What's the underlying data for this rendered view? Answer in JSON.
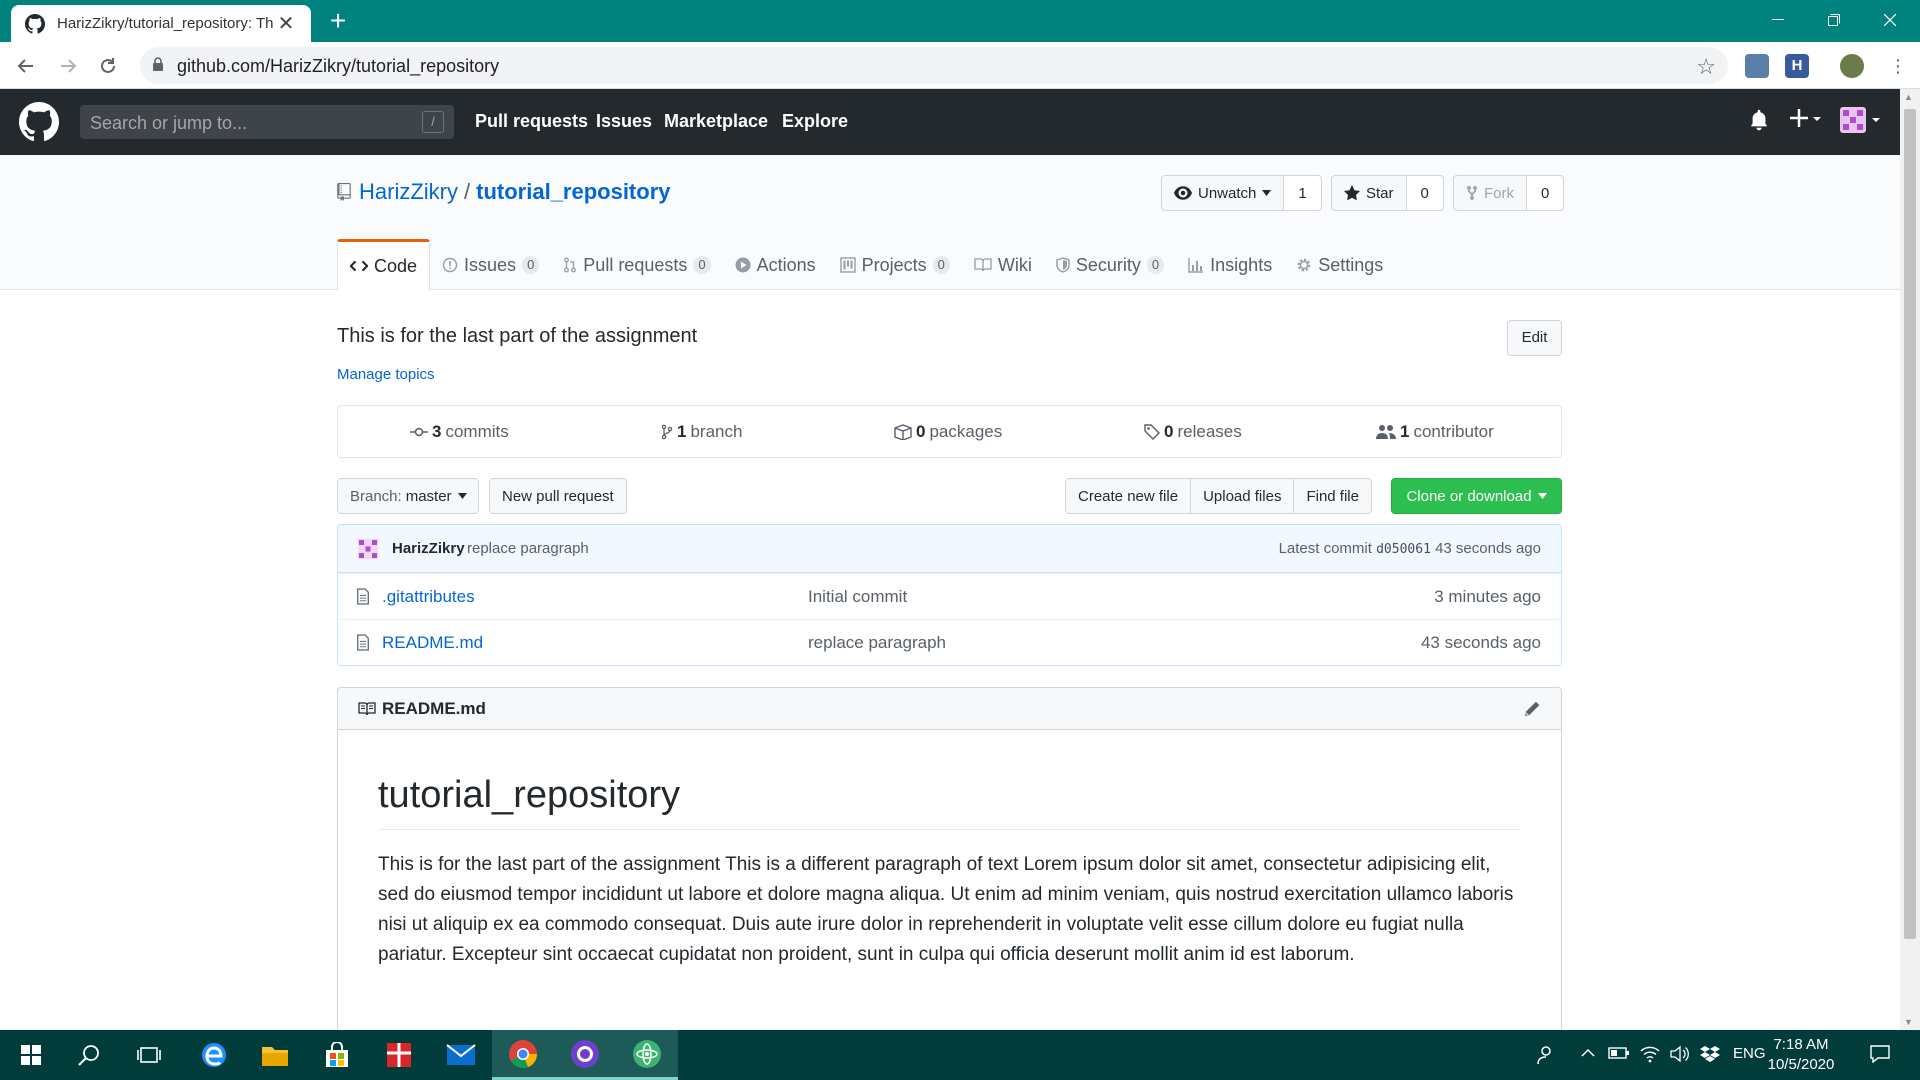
{
  "browser": {
    "tab_title": "HarizZikry/tutorial_repository: Th",
    "tab_close": "✕",
    "new_tab": "+",
    "url": "github.com/HarizZikry/tutorial_repository",
    "ext_h_label": "H"
  },
  "gh": {
    "search_placeholder": "Search or jump to...",
    "search_shortcut": "/",
    "nav": [
      "Pull requests",
      "Issues",
      "Marketplace",
      "Explore"
    ]
  },
  "repo": {
    "owner": "HarizZikry",
    "separator": "/",
    "name": "tutorial_repository",
    "unwatch_label": "Unwatch",
    "watch_count": "1",
    "star_label": "Star",
    "star_count": "0",
    "fork_label": "Fork",
    "fork_count": "0",
    "tabs": [
      {
        "label": "Code",
        "count": ""
      },
      {
        "label": "Issues",
        "count": "0"
      },
      {
        "label": "Pull requests",
        "count": "0"
      },
      {
        "label": "Actions",
        "count": ""
      },
      {
        "label": "Projects",
        "count": "0"
      },
      {
        "label": "Wiki",
        "count": ""
      },
      {
        "label": "Security",
        "count": "0"
      },
      {
        "label": "Insights",
        "count": ""
      },
      {
        "label": "Settings",
        "count": ""
      }
    ],
    "description": "This is for the last part of the assignment",
    "edit_label": "Edit",
    "manage_topics": "Manage topics"
  },
  "summary": {
    "commits_num": "3",
    "commits_label": "commits",
    "branch_num": "1",
    "branch_label": "branch",
    "packages_num": "0",
    "packages_label": "packages",
    "releases_num": "0",
    "releases_label": "releases",
    "contributor_num": "1",
    "contributor_label": "contributor"
  },
  "actions": {
    "branch_prefix": "Branch:",
    "branch_name": "master",
    "new_pr": "New pull request",
    "create_file": "Create new file",
    "upload_files": "Upload files",
    "find_file": "Find file",
    "clone": "Clone or download"
  },
  "commit": {
    "author": "HarizZikry",
    "message": "replace paragraph",
    "latest_prefix": "Latest commit",
    "sha": "d050061",
    "age": "43 seconds ago"
  },
  "files": [
    {
      "name": ".gitattributes",
      "message": "Initial commit",
      "age": "3 minutes ago"
    },
    {
      "name": "README.md",
      "message": "replace paragraph",
      "age": "43 seconds ago"
    }
  ],
  "readme": {
    "file_label": "README.md",
    "heading": "tutorial_repository",
    "paragraph": "This is for the last part of the assignment This is a different paragraph of text Lorem ipsum dolor sit amet, consectetur adipisicing elit, sed do eiusmod tempor incididunt ut labore et dolore magna aliqua. Ut enim ad minim veniam, quis nostrud exercitation ullamco laboris nisi ut aliquip ex ea commodo consequat. Duis aute irure dolor in reprehenderit in voluptate velit esse cillum dolore eu fugiat nulla pariatur. Excepteur sint occaecat cupidatat non proident, sunt in culpa qui officia deserunt mollit anim id est laborum."
  },
  "taskbar": {
    "language": "ENG",
    "time": "7:18 AM",
    "date": "10/5/2020"
  },
  "colors": {
    "titlebar": "#00837f",
    "github_header": "#24292e",
    "link": "#0366d6",
    "green_button": "#2cbe4e",
    "tab_accent": "#e36209",
    "taskbar": "#003c3a"
  }
}
